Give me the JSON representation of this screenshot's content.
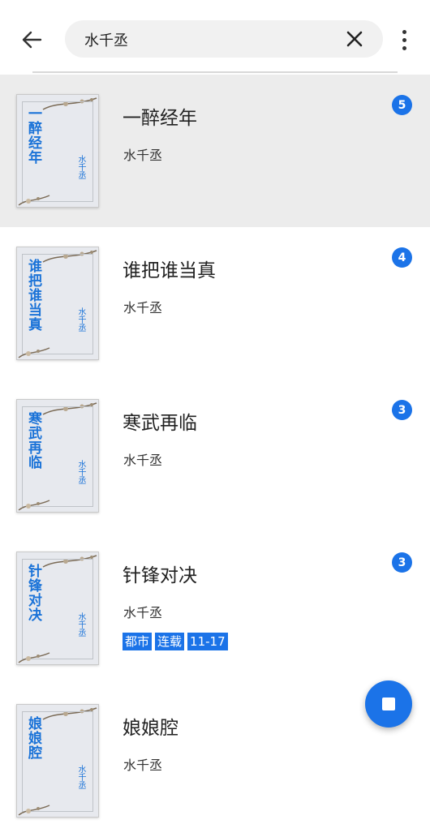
{
  "search": {
    "query": "水千丞"
  },
  "icons": {
    "back": "arrow-left-icon",
    "clear": "close-icon",
    "more": "more-vert-icon",
    "fab": "stop-icon"
  },
  "colors": {
    "accent": "#1b73e8",
    "selected_row": "#ececec"
  },
  "books": [
    {
      "title": "一醉经年",
      "author": "水千丞",
      "cover_title": "一醉经年",
      "cover_author": "水千丞",
      "badge": "5",
      "selected": true,
      "tags": []
    },
    {
      "title": "谁把谁当真",
      "author": "水千丞",
      "cover_title": "谁把谁当真",
      "cover_author": "水千丞",
      "badge": "4",
      "selected": false,
      "tags": []
    },
    {
      "title": "寒武再临",
      "author": "水千丞",
      "cover_title": "寒武再临",
      "cover_author": "水千丞",
      "badge": "3",
      "selected": false,
      "tags": []
    },
    {
      "title": "针锋对决",
      "author": "水千丞",
      "cover_title": "针锋对决",
      "cover_author": "水千丞",
      "badge": "3",
      "selected": false,
      "tags": [
        "都市",
        "连载",
        "11-17"
      ]
    },
    {
      "title": "娘娘腔",
      "author": "水千丞",
      "cover_title": "娘娘腔",
      "cover_author": "水千丞",
      "badge": "",
      "selected": false,
      "tags": []
    }
  ]
}
